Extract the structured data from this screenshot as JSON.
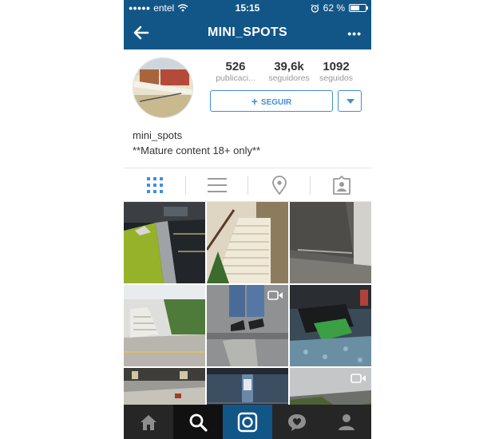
{
  "status_bar": {
    "carrier": "entel",
    "time": "15:15",
    "battery": "62 %",
    "battery_level": 0.62,
    "signal_dots": "●●●●●"
  },
  "nav": {
    "title": "MINI_SPOTS",
    "back_icon": "back-arrow-icon",
    "more_label": "•••"
  },
  "profile": {
    "stats": [
      {
        "value": "526",
        "label": "publicaci..."
      },
      {
        "value": "39,6k",
        "label": "seguidores"
      },
      {
        "value": "1092",
        "label": "seguidos"
      }
    ],
    "follow_label": "SEGUIR",
    "follow_icon": "+",
    "username": "mini_spots",
    "bio": "**Mature content 18+ only**"
  },
  "view_tabs": {
    "items": [
      "grid-icon",
      "list-icon",
      "location-pin-icon",
      "tagged-photos-icon"
    ],
    "selected": "grid-icon"
  },
  "tab_bar": {
    "items": [
      "home-icon",
      "search-icon",
      "camera-icon",
      "activity-heart-icon",
      "profile-icon"
    ],
    "selected": "search-icon"
  },
  "colors": {
    "brand": "#125688",
    "accent": "#3f8fd9",
    "tabbar": "#262626"
  }
}
